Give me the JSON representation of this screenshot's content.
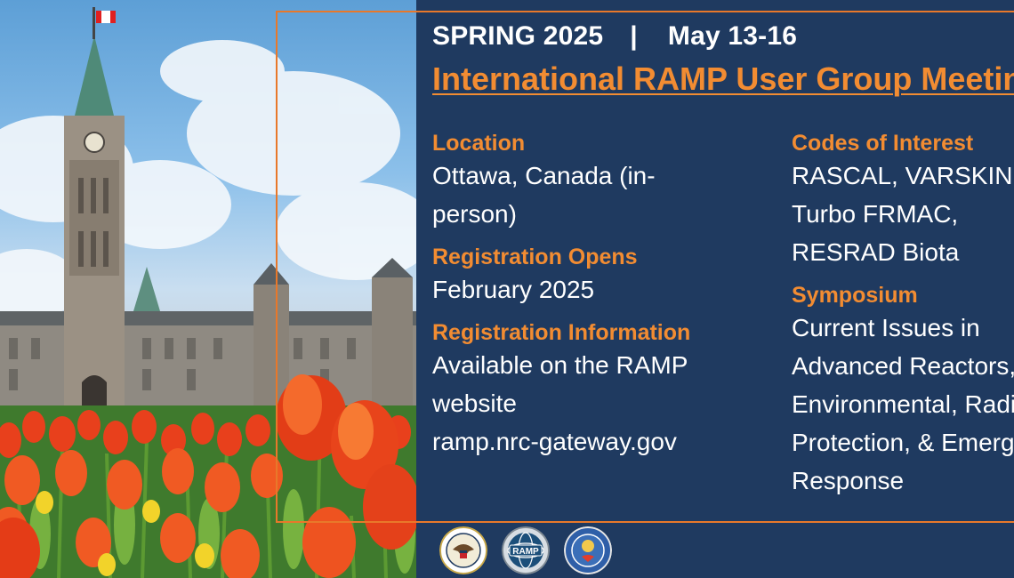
{
  "banner": {
    "season": "SPRING 2025",
    "separator": "|",
    "dates": "May 13-16",
    "title": "International RAMP User Group Meeting",
    "sections_left": [
      {
        "label": "Location",
        "lines": [
          "Ottawa, Canada (in-",
          "person)"
        ]
      },
      {
        "label": "Registration Opens",
        "lines": [
          "February 2025"
        ]
      },
      {
        "label": "Registration Information",
        "lines": [
          "Available on the RAMP",
          "website",
          "ramp.nrc-gateway.gov"
        ]
      }
    ],
    "sections_right": [
      {
        "label": "Codes of Interest",
        "lines": [
          "RASCAL, VARSKIN,",
          "Turbo FRMAC,",
          "RESRAD Biota"
        ]
      },
      {
        "label": "Symposium",
        "lines": [
          "Current Issues in",
          "Advanced Reactors,",
          "Environmental, Radiation",
          "Protection, & Emergency",
          "Response"
        ]
      }
    ]
  },
  "logos": [
    {
      "name": "nrc-seal-icon"
    },
    {
      "name": "ramp-logo-icon",
      "text": "RAMP"
    },
    {
      "name": "cnsc-logo-icon"
    }
  ],
  "colors": {
    "panel": "#1f3a60",
    "accent": "#f28c32",
    "frame": "#e8782a",
    "text": "#ffffff"
  }
}
